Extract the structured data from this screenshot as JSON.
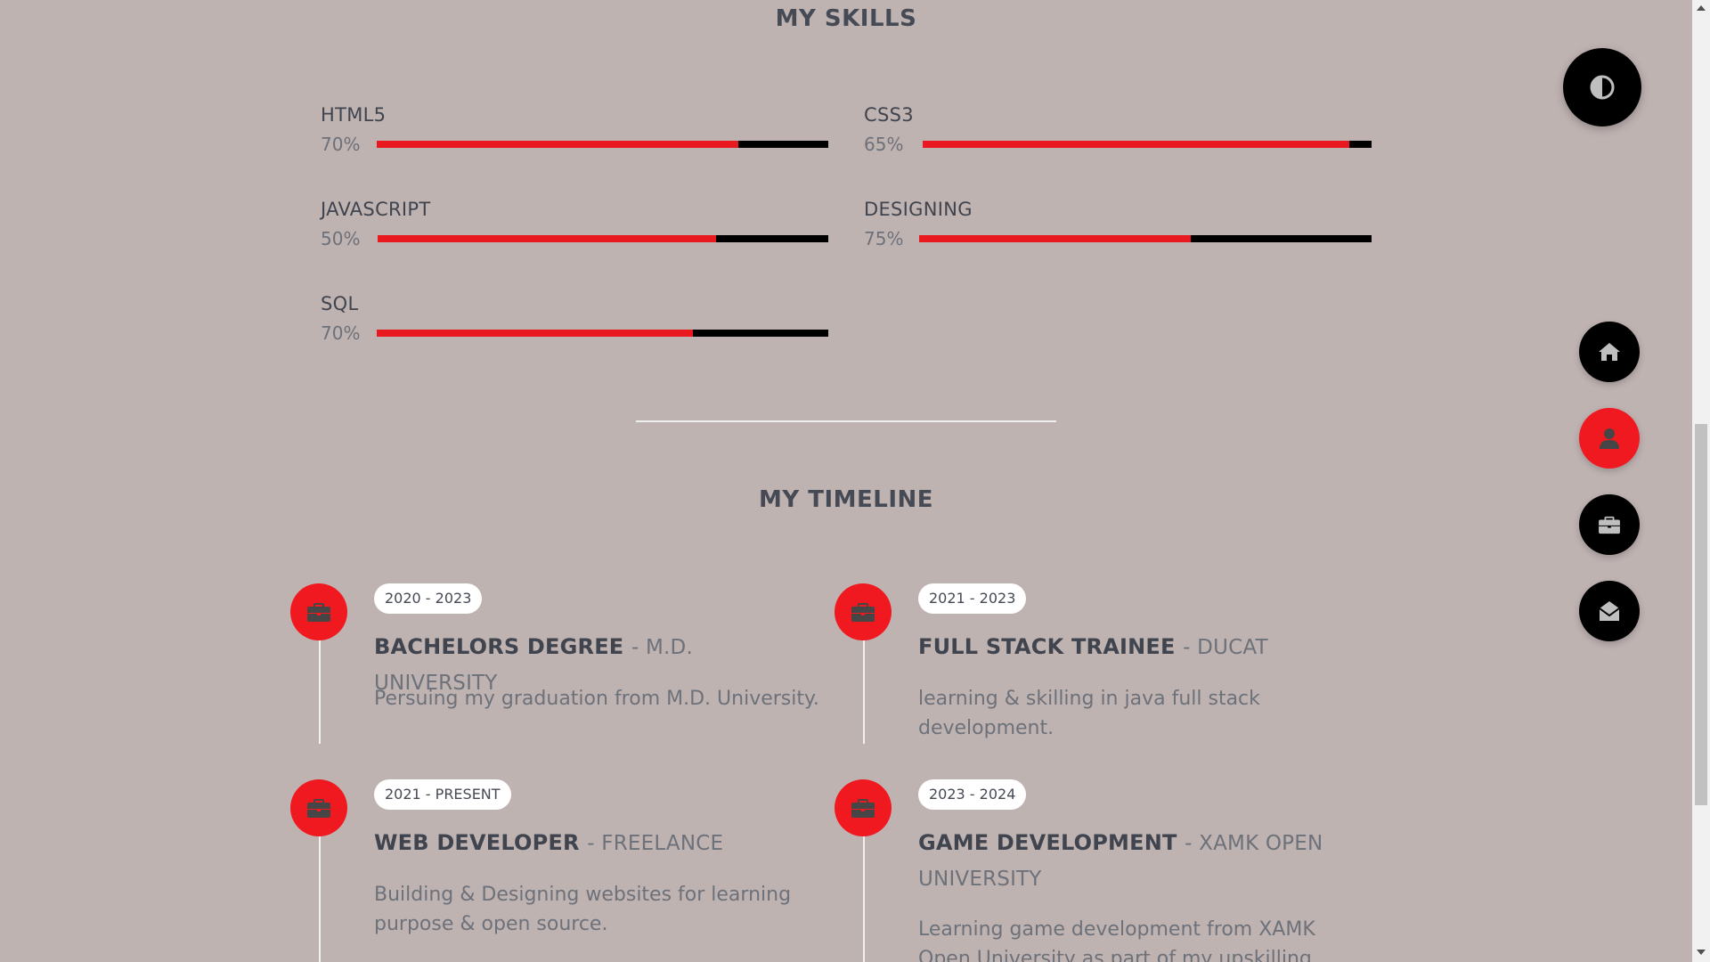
{
  "skills": {
    "title": "MY SKILLS",
    "items": [
      {
        "name": "HTML5",
        "percent_label": "70%",
        "fill": 0.8
      },
      {
        "name": "CSS3",
        "percent_label": "65%",
        "fill": 0.95
      },
      {
        "name": "JAVASCRIPT",
        "percent_label": "50%",
        "fill": 0.75
      },
      {
        "name": "DESIGNING",
        "percent_label": "75%",
        "fill": 0.6
      },
      {
        "name": "SQL",
        "percent_label": "70%",
        "fill": 0.7
      }
    ]
  },
  "timeline": {
    "title": "MY TIMELINE",
    "items": [
      {
        "date": "2020 - 2023",
        "title": "BACHELORS DEGREE",
        "org": "- M.D. UNIVERSITY",
        "description": "Persuing my graduation from M.D. University.",
        "icon": "briefcase-icon"
      },
      {
        "date": "2021 - 2023",
        "title": "FULL STACK TRAINEE",
        "org": "- DUCAT",
        "description": "learning & skilling in java full stack development.",
        "icon": "briefcase-icon"
      },
      {
        "date": "2021 - PRESENT",
        "title": "WEB DEVELOPER",
        "org": "- FREELANCE",
        "description": "Building & Designing websites for learning purpose & open source.",
        "icon": "briefcase-icon"
      },
      {
        "date": "2023 - 2024",
        "title": "GAME DEVELOPMENT",
        "org": "- XAMK OPEN UNIVERSITY",
        "description": "Learning game development from XAMK Open University as part of my upskilling",
        "icon": "briefcase-icon"
      }
    ]
  },
  "controls": {
    "theme_toggle_icon": "contrast-icon",
    "nav": [
      {
        "name": "home",
        "icon": "home-icon",
        "active": false
      },
      {
        "name": "about",
        "icon": "user-icon",
        "active": true
      },
      {
        "name": "portfolio",
        "icon": "briefcase-icon",
        "active": false
      },
      {
        "name": "contact",
        "icon": "envelope-open-icon",
        "active": false
      }
    ]
  },
  "colors": {
    "background": "#bfb3b2",
    "accent": "#f0191f",
    "bar_track": "#000000",
    "heading": "#454a54",
    "muted": "#6d717a"
  }
}
